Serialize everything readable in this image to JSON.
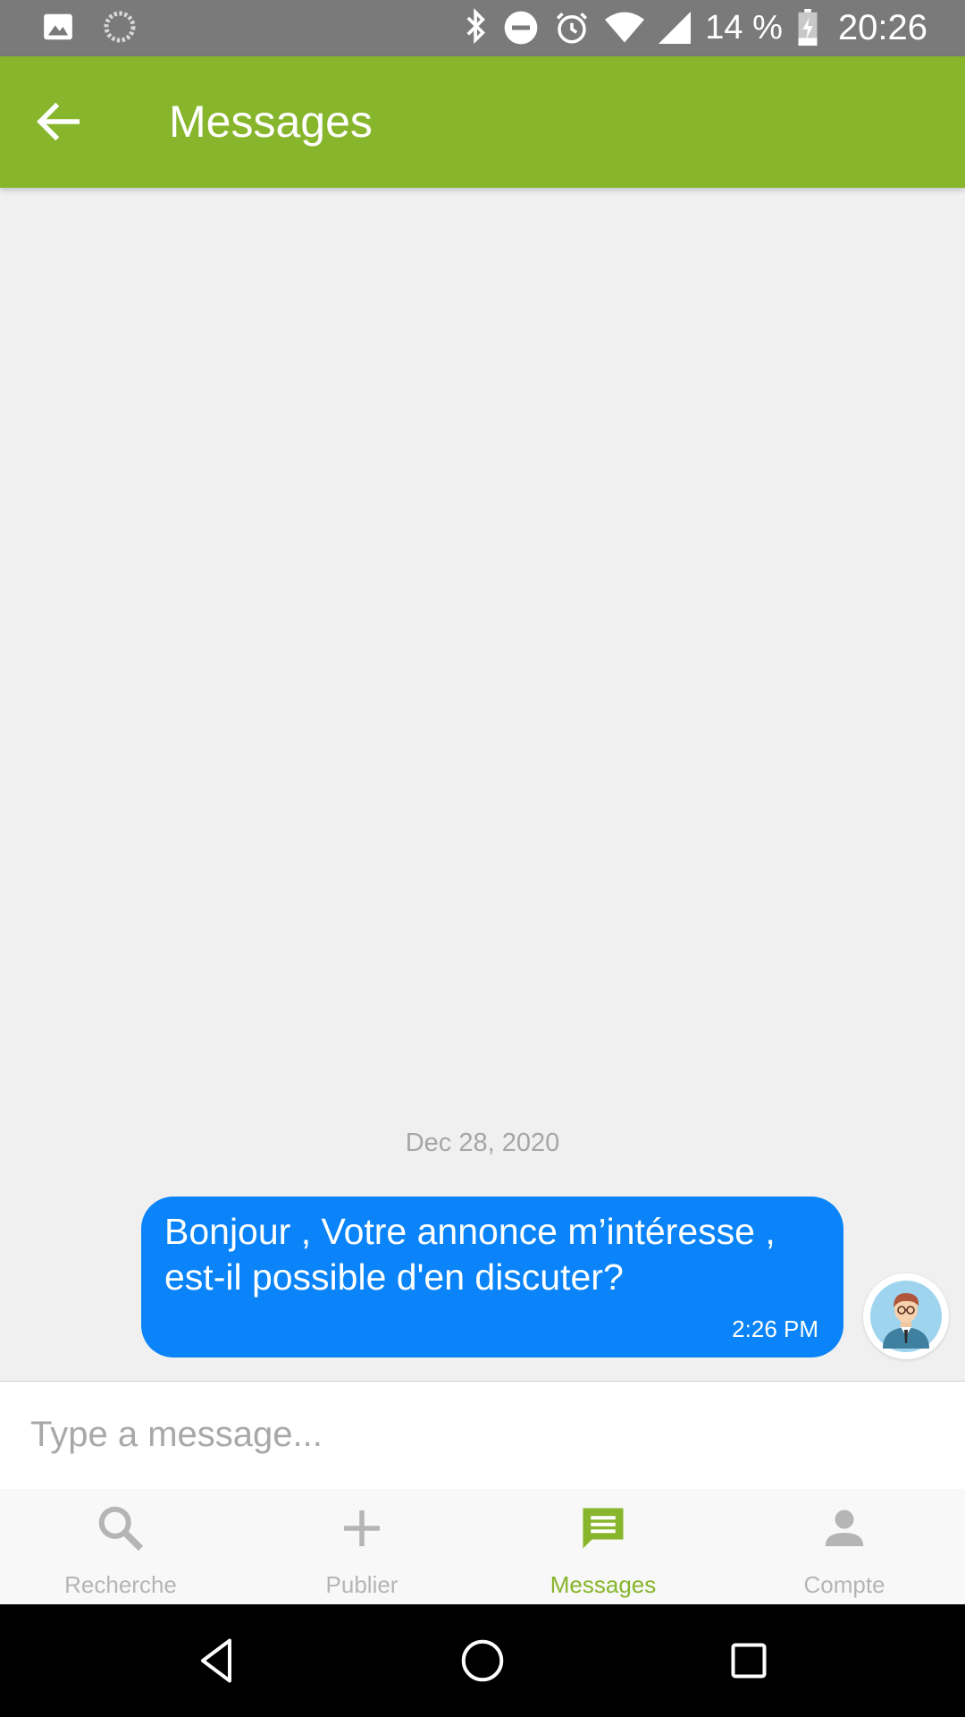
{
  "status_bar": {
    "battery_percent": "14 %",
    "time": "20:26",
    "icons": [
      "image-icon",
      "sync-icon",
      "bluetooth-icon",
      "do-not-disturb-icon",
      "alarm-icon",
      "wifi-icon",
      "signal-icon",
      "battery-charging-icon"
    ]
  },
  "app_bar": {
    "title": "Messages",
    "back_icon": "arrow-back-icon",
    "color": "#87b52b"
  },
  "chat": {
    "date": "Dec 28, 2020",
    "messages": [
      {
        "text": "Bonjour , Votre annonce m’intéresse , est-il possible d'en discuter?",
        "time": "2:26 PM",
        "sender": "self",
        "bubble_color": "#0a84f8"
      }
    ]
  },
  "composer": {
    "placeholder": "Type a message..."
  },
  "tab_bar": {
    "items": [
      {
        "label": "Recherche",
        "icon": "search-icon",
        "active": false
      },
      {
        "label": "Publier",
        "icon": "plus-icon",
        "active": false
      },
      {
        "label": "Messages",
        "icon": "message-icon",
        "active": true
      },
      {
        "label": "Compte",
        "icon": "person-icon",
        "active": false
      }
    ],
    "active_color": "#87b52b",
    "inactive_color": "#b5b5b5"
  },
  "nav_bar": {
    "icons": [
      "nav-back-icon",
      "nav-home-icon",
      "nav-recents-icon"
    ]
  }
}
